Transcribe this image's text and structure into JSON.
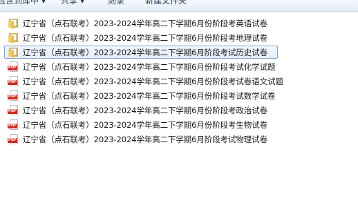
{
  "toolbar": {
    "include_library": "包含到库中",
    "share": "共享",
    "burn": "刻录",
    "new_folder": "新建文件夹"
  },
  "files": [
    {
      "name": "辽宁省（点石联考）2023-2024学年高二下学期6月份阶段考英语试卷",
      "type": "folder",
      "selected": false
    },
    {
      "name": "辽宁省（点石联考）2023-2024学年高二下学期6月份阶段考地理试卷",
      "type": "folder",
      "selected": false
    },
    {
      "name": "辽宁省（点石联考）2023-2024学年高二下学期6月阶段考试历史试卷",
      "type": "folder",
      "selected": true
    },
    {
      "name": "辽宁省（点石联考）2023-2024学年高二下学期6月份阶段考试化学试题",
      "type": "pdf",
      "selected": false
    },
    {
      "name": "辽宁省（点石联考）2023-2024学年高二下学期6月份阶段考试卷语文试题",
      "type": "pdf",
      "selected": false
    },
    {
      "name": "辽宁省（点石联考）2023-2024学年高二下学期6月份阶段考试数学试卷",
      "type": "pdf",
      "selected": false
    },
    {
      "name": "辽宁省（点石联考）2023-2024学年高二下学期6月份阶段考政治试卷",
      "type": "pdf",
      "selected": false
    },
    {
      "name": "辽宁省（点石联考）2023-2024学年高二下学期6月份阶段考生物试卷",
      "type": "pdf",
      "selected": false
    },
    {
      "name": "辽宁省（点石联考）2023-2024学年高二下学期6月阶段考试物理试卷",
      "type": "pdf",
      "selected": false
    }
  ],
  "icons": {
    "folder": "folder-icon",
    "pdf": "pdf-icon"
  },
  "pdf_badge": "PDF",
  "colors": {
    "pdf_red": "#d0281f",
    "folder_yellow": "#e8b94a",
    "selection": "#e5eefa"
  }
}
